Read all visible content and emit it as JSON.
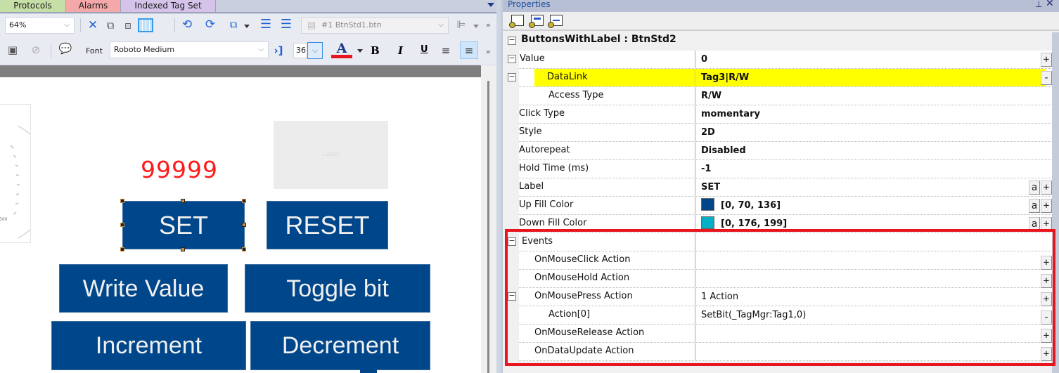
{
  "tabs": [
    {
      "label": "Protocols",
      "color": "#c6dfa6"
    },
    {
      "label": "Alarms",
      "color": "#f4a8a8"
    },
    {
      "label": "Indexed Tag Set",
      "color": "#d5c3ea"
    }
  ],
  "toolbar": {
    "zoom_value": "64%",
    "page_select_value": "#1 BtnStd1.btn",
    "font_label": "Font",
    "font_value": "Roboto Medium",
    "font_size_value": "36",
    "font_color": "#e8141e",
    "bold_label": "B",
    "italic_label": "I",
    "underline_label": "U",
    "text_color_label": "A",
    "more_label": "»"
  },
  "canvas": {
    "gauge_tick_label": "500",
    "numeric_display": "99999",
    "label_placeholder": "Label",
    "button_fill": "#00468a",
    "buttons": {
      "set": "SET",
      "reset": "RESET",
      "write_value": "Write Value",
      "toggle_bit": "Toggle bit",
      "increment": "Increment",
      "decrement": "Decrement"
    }
  },
  "properties": {
    "title": "Properties",
    "pin_icon": "⊥",
    "close_icon": "✕",
    "object_header": "ButtonsWithLabel : BtnStd2",
    "rows": [
      {
        "name": "Value",
        "value": "0",
        "bold": true,
        "expander": "−",
        "button": "+"
      },
      {
        "name": "DataLink",
        "value": "Tag3|R/W",
        "bold": true,
        "expander": "−",
        "button": "-",
        "highlight": true,
        "highlight_color": "#ffff00"
      },
      {
        "name": "Access Type",
        "value": "R/W",
        "bold": true
      },
      {
        "name": "Click Type",
        "value": "momentary",
        "bold": true
      },
      {
        "name": "Style",
        "value": "2D",
        "bold": true
      },
      {
        "name": "Autorepeat",
        "value": "Disabled",
        "bold": true
      },
      {
        "name": "Hold Time (ms)",
        "value": "-1",
        "bold": true
      },
      {
        "name": "Label",
        "value": "SET",
        "bold": true,
        "a_button": "a",
        "button": "+"
      },
      {
        "name": "Up Fill Color",
        "value": "[0, 70, 136]",
        "bold": true,
        "swatch": "#004688",
        "a_button": "a",
        "button": "+"
      },
      {
        "name": "Down Fill Color",
        "value": "[0, 176, 199]",
        "bold": true,
        "swatch": "#00b0c7",
        "a_button": "a",
        "button": "+"
      }
    ],
    "events": {
      "label": "Events",
      "expander": "−",
      "rows": [
        {
          "name": "OnMouseClick Action",
          "value": "",
          "button": "+"
        },
        {
          "name": "OnMouseHold Action",
          "value": "",
          "button": "+"
        },
        {
          "name": "OnMousePress Action",
          "value": "1 Action",
          "button": "+",
          "expander": "−"
        },
        {
          "name": "Action[0]",
          "value": "SetBit(_TagMgr:Tag1,0)",
          "button": "-"
        },
        {
          "name": "OnMouseRelease Action",
          "value": "",
          "button": "+"
        },
        {
          "name": "OnDataUpdate Action",
          "value": "",
          "button": "+"
        }
      ]
    },
    "highlight_box_color": "#e8141e"
  }
}
